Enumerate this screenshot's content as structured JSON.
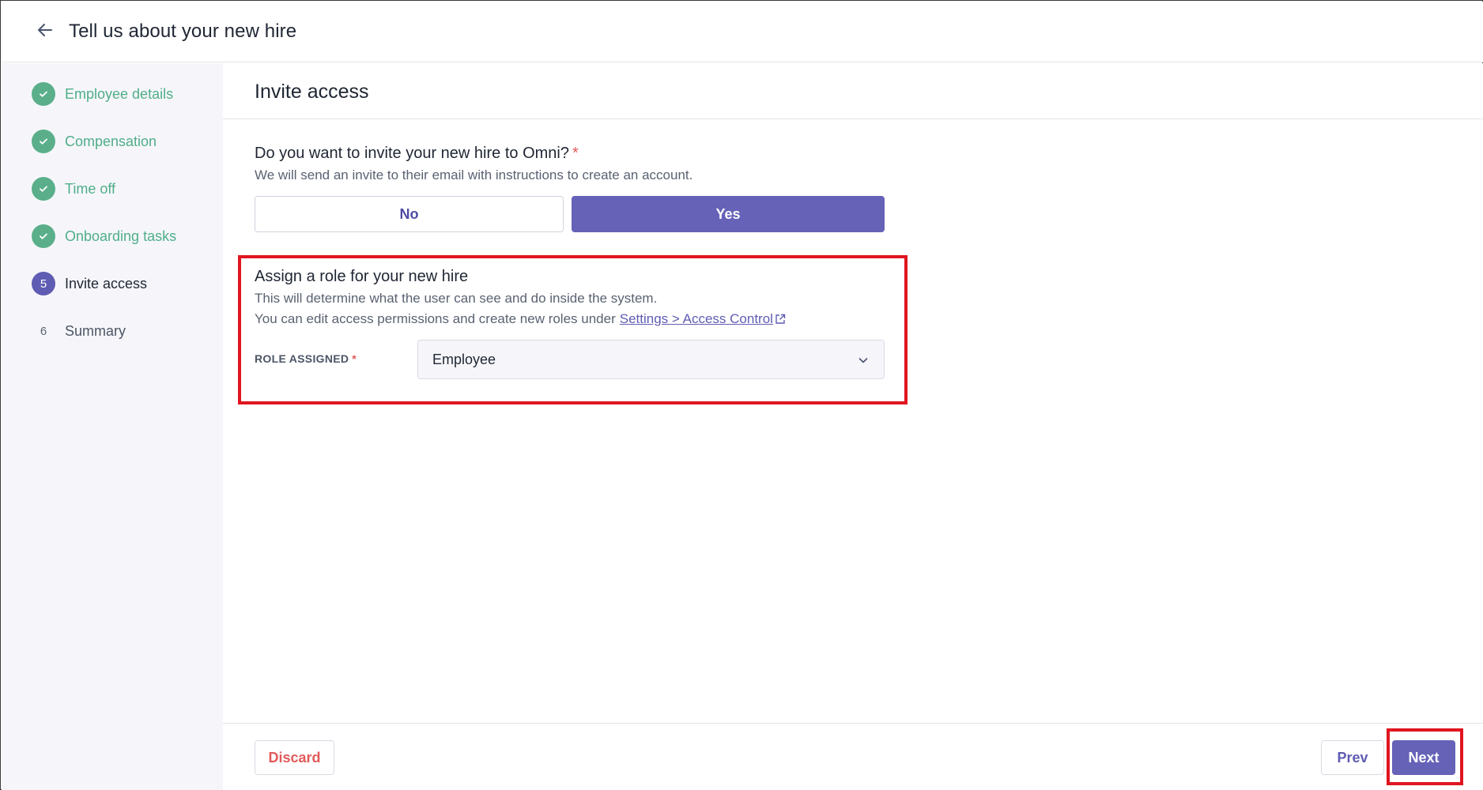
{
  "header": {
    "title": "Tell us about your new hire",
    "back_icon": "arrow-left-icon"
  },
  "sidebar": {
    "steps": [
      {
        "label": "Employee details",
        "status": "done",
        "marker": ""
      },
      {
        "label": "Compensation",
        "status": "done",
        "marker": ""
      },
      {
        "label": "Time off",
        "status": "done",
        "marker": ""
      },
      {
        "label": "Onboarding tasks",
        "status": "done",
        "marker": ""
      },
      {
        "label": "Invite access",
        "status": "current",
        "marker": "5"
      },
      {
        "label": "Summary",
        "status": "pending",
        "marker": "6"
      }
    ]
  },
  "main": {
    "section_title": "Invite access",
    "invite_question": {
      "title": "Do you want to invite your new hire to Omni?",
      "required_mark": "*",
      "subtitle": "We will send an invite to their email with instructions to create an account.",
      "options": {
        "no": "No",
        "yes": "Yes"
      },
      "selected": "Yes"
    },
    "role": {
      "title": "Assign a role for your new hire",
      "subtitle1": "This will determine what the user can see and do inside the system.",
      "subtitle2": "You can edit access permissions and create new roles under",
      "link_text": "Settings > Access Control",
      "field_label": "ROLE ASSIGNED",
      "required_mark": "*",
      "selected_value": "Employee"
    }
  },
  "footer": {
    "discard_label": "Discard",
    "prev_label": "Prev",
    "next_label": "Next"
  },
  "colors": {
    "accent": "#6562b8",
    "success": "#4fae88",
    "danger": "#e35a5a",
    "highlight": "#e0151f"
  }
}
